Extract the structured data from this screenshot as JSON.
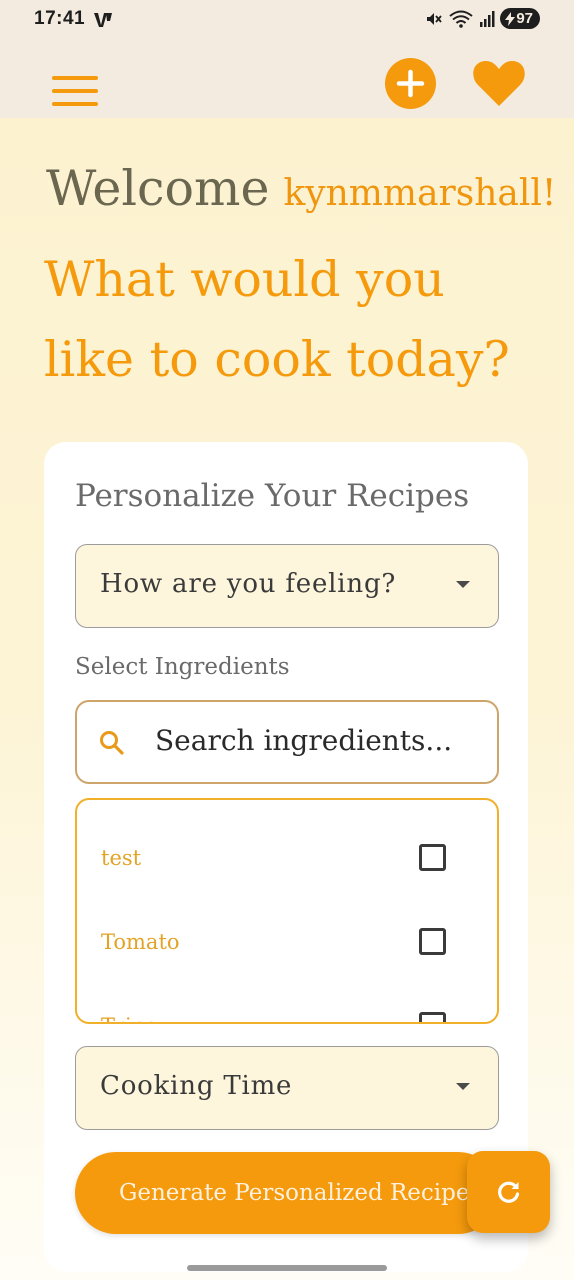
{
  "status_bar": {
    "time": "17:41",
    "battery": "97",
    "icons": [
      "notification-app-icon",
      "mute-icon",
      "wifi-icon",
      "signal-icon",
      "battery-icon"
    ]
  },
  "app_bar": {
    "icons": [
      "menu-icon",
      "add-icon",
      "heart-icon"
    ],
    "accent_color": "#f59a0c"
  },
  "greeting": {
    "welcome": "Welcome",
    "username": "kynmmarshall!",
    "question": "What would you like to cook today?"
  },
  "personalize": {
    "title": "Personalize Your Recipes",
    "mood_select": {
      "placeholder": "How are you feeling?"
    },
    "ingredients_label": "Select Ingredients",
    "search": {
      "placeholder": "Search ingredients..."
    },
    "ingredients": [
      {
        "label": "test",
        "checked": false
      },
      {
        "label": "Tomato",
        "checked": false
      },
      {
        "label": "Tripe",
        "checked": false
      }
    ],
    "cooking_time_select": {
      "placeholder": "Cooking Time"
    },
    "generate_label": "Generate Personalized Recipes"
  },
  "fab": {
    "icon": "refresh-icon"
  }
}
